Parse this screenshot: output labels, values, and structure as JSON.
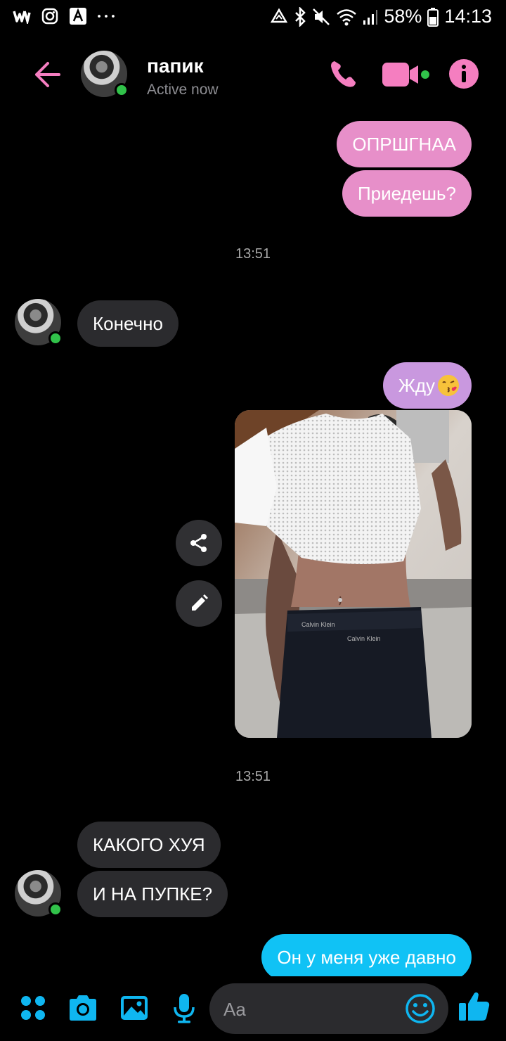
{
  "status_bar": {
    "battery": "58%",
    "time": "14:13"
  },
  "header": {
    "contact_name": "папик",
    "contact_status": "Active now"
  },
  "messages": {
    "m1": "ОПРШГНАА",
    "m2": "Приедешь?",
    "ts1": "13:51",
    "m3": "Конечно",
    "m4": "Жду",
    "ts2": "13:51",
    "m5": "КАКОГО ХУЯ",
    "m6": "И НА ПУПКЕ?",
    "m7": "Он у меня уже давно"
  },
  "composer": {
    "placeholder": "Aa"
  },
  "colors": {
    "accent_pink": "#f57ec0",
    "accent_blue": "#0fb6f0",
    "online": "#31c24a"
  }
}
